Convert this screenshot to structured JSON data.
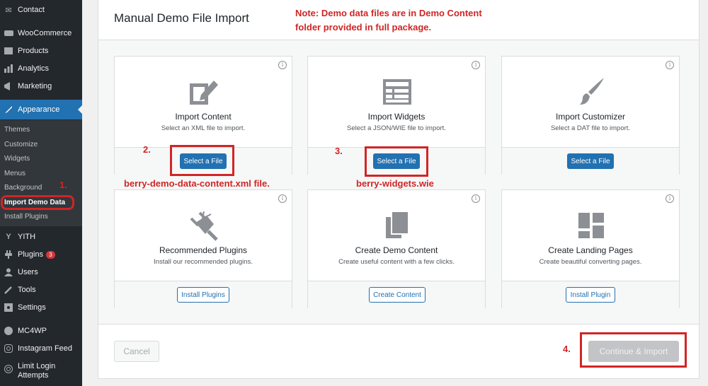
{
  "sidebar": {
    "items": [
      {
        "label": "Contact",
        "icon": "contact-icon"
      },
      {
        "label": "WooCommerce",
        "icon": "woocommerce-icon"
      },
      {
        "label": "Products",
        "icon": "products-icon"
      },
      {
        "label": "Analytics",
        "icon": "analytics-icon"
      },
      {
        "label": "Marketing",
        "icon": "marketing-icon"
      },
      {
        "label": "Appearance",
        "icon": "appearance-icon"
      },
      {
        "label": "YITH",
        "icon": "yith-icon"
      },
      {
        "label": "Plugins",
        "icon": "plugins-icon",
        "badge": "3"
      },
      {
        "label": "Users",
        "icon": "users-icon"
      },
      {
        "label": "Tools",
        "icon": "tools-icon"
      },
      {
        "label": "Settings",
        "icon": "settings-icon"
      },
      {
        "label": "MC4WP",
        "icon": "mc4wp-icon"
      },
      {
        "label": "Instagram Feed",
        "icon": "instagram-icon"
      },
      {
        "label": "Limit Login Attempts",
        "label_line1": "Limit Login",
        "label_line2": "Attempts",
        "icon": "limit-login-icon"
      }
    ],
    "submenu": [
      {
        "label": "Themes"
      },
      {
        "label": "Customize"
      },
      {
        "label": "Widgets"
      },
      {
        "label": "Menus"
      },
      {
        "label": "Background"
      },
      {
        "label": "Import Demo Data",
        "current": true
      },
      {
        "label": "Install Plugins"
      }
    ]
  },
  "page": {
    "title": "Manual Demo File Import",
    "note_line1": "Note: Demo data files are in Demo Content",
    "note_line2": "folder provided in full package."
  },
  "cards": [
    {
      "title": "Import Content",
      "desc": "Select an XML file to import.",
      "button": "Select a File",
      "icon": "import-content-icon"
    },
    {
      "title": "Import Widgets",
      "desc": "Select a JSON/WIE file to import.",
      "button": "Select a File",
      "icon": "import-widgets-icon"
    },
    {
      "title": "Import Customizer",
      "desc": "Select a DAT file to import.",
      "button": "Select a File",
      "icon": "paintbrush-icon"
    },
    {
      "title": "Recommended Plugins",
      "desc": "Install our recommended plugins.",
      "button": "Install Plugins",
      "icon": "plugin-icon"
    },
    {
      "title": "Create Demo Content",
      "desc": "Create useful content with a few clicks.",
      "button": "Create Content",
      "icon": "copy-pages-icon"
    },
    {
      "title": "Create Landing Pages",
      "desc": "Create beautiful converting pages.",
      "button": "Install Plugin",
      "icon": "layout-icon"
    }
  ],
  "annotations": {
    "step1": "1.",
    "step2": "2.",
    "step3": "3.",
    "step4": "4.",
    "file1": "berry-demo-data-content.xml file.",
    "file2": "berry-widgets.wie"
  },
  "footer": {
    "cancel_label": "Cancel",
    "continue_label": "Continue & Import"
  },
  "colors": {
    "accent": "#2271b1",
    "annotation": "#d12525",
    "sidebar_bg": "#23282d"
  }
}
